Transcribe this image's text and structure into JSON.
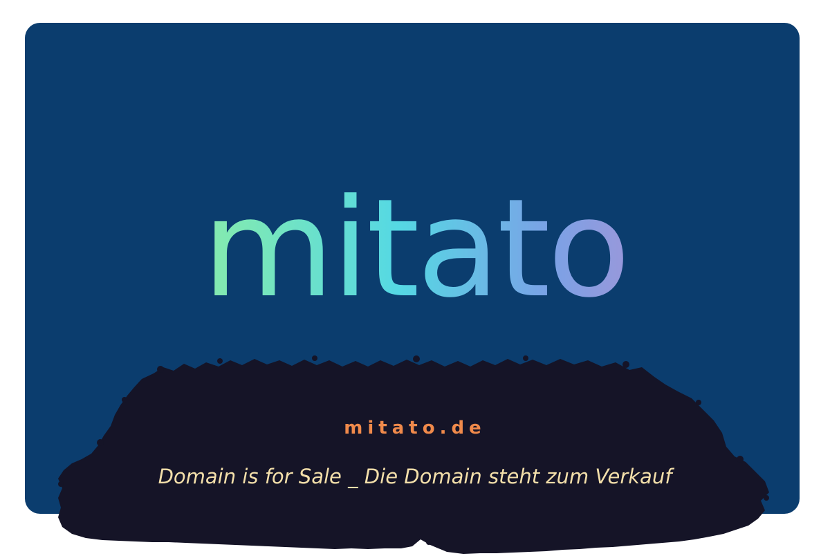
{
  "logo": {
    "text": "mitato"
  },
  "domain": {
    "name": "mitato.de",
    "sale_text": "Domain is for Sale _ Die Domain steht zum Verkauf"
  },
  "colors": {
    "card_background": "#0b3d6e",
    "blob_fill": "#151427",
    "domain_name": "#f08a4b",
    "sale_text": "#f3dfaa",
    "logo_gradient": [
      "#b8e48e",
      "#7fe9b4",
      "#55d8e4",
      "#7aa2e6",
      "#b68ed0"
    ]
  }
}
